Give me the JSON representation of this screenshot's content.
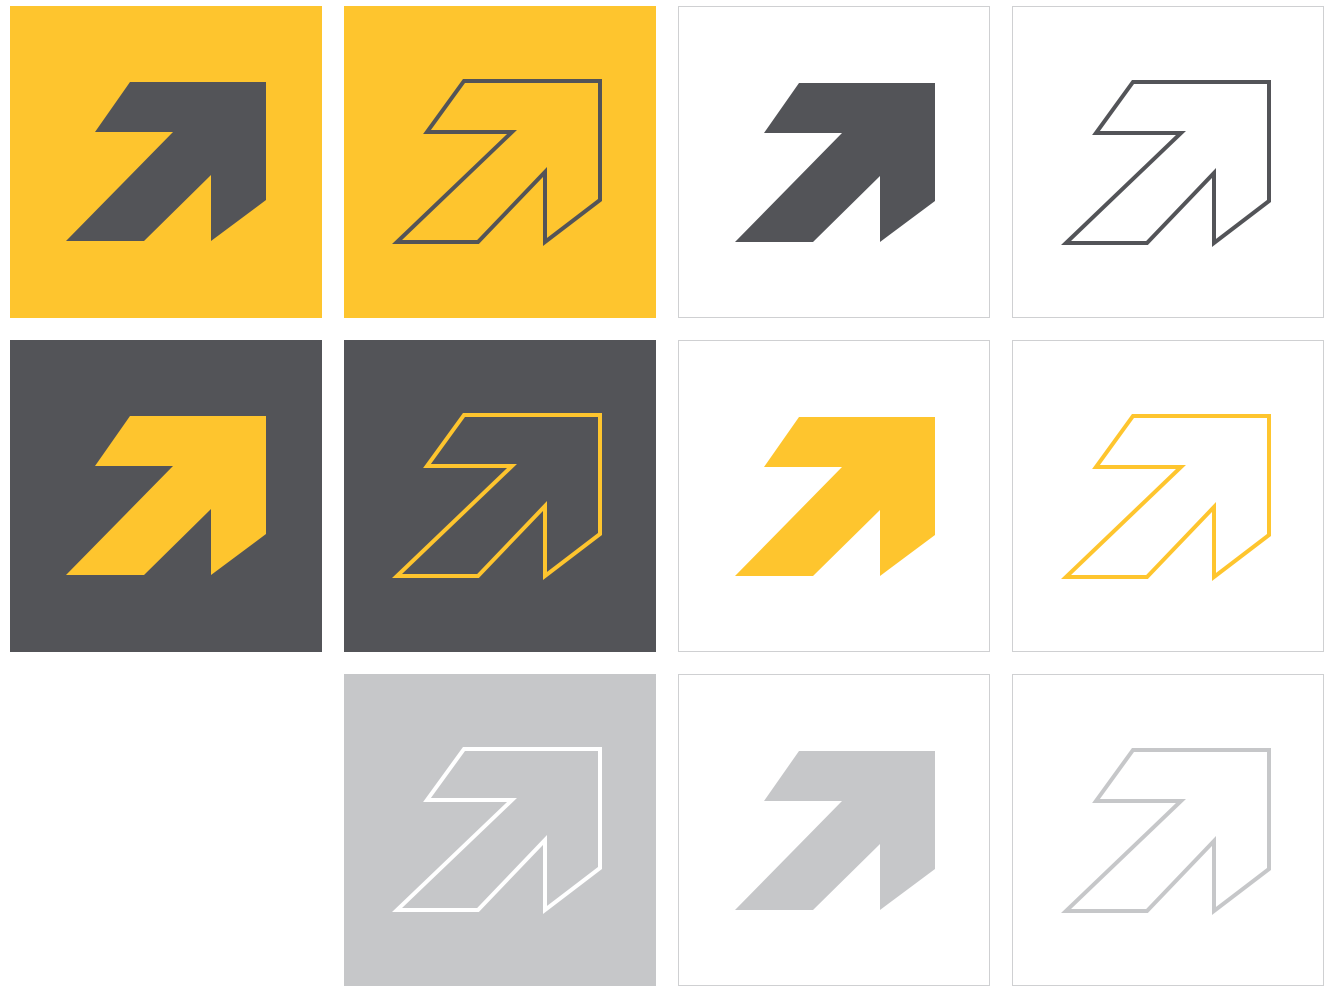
{
  "colors": {
    "yellow": "#fec52e",
    "charcoal": "#535458",
    "light_gray": "#c6c7c9",
    "white": "#ffffff",
    "tile_border": "#cfd0d2"
  },
  "tiles": [
    {
      "name": "arrow-tile-yellow-bg-solid-charcoal",
      "bg": "#fec52e",
      "style": "solid",
      "mark": "#535458",
      "bordered": false
    },
    {
      "name": "arrow-tile-yellow-bg-outline-charcoal",
      "bg": "#fec52e",
      "style": "outline",
      "mark": "#535458",
      "bordered": false
    },
    {
      "name": "arrow-tile-white-bg-solid-charcoal",
      "bg": "#ffffff",
      "style": "solid",
      "mark": "#535458",
      "bordered": true
    },
    {
      "name": "arrow-tile-white-bg-outline-charcoal",
      "bg": "#ffffff",
      "style": "outline",
      "mark": "#535458",
      "bordered": true
    },
    {
      "name": "arrow-tile-charcoal-bg-solid-yellow",
      "bg": "#535458",
      "style": "solid",
      "mark": "#fec52e",
      "bordered": false
    },
    {
      "name": "arrow-tile-charcoal-bg-outline-yellow",
      "bg": "#535458",
      "style": "outline",
      "mark": "#fec52e",
      "bordered": false
    },
    {
      "name": "arrow-tile-white-bg-solid-yellow",
      "bg": "#ffffff",
      "style": "solid",
      "mark": "#fec52e",
      "bordered": true
    },
    {
      "name": "arrow-tile-white-bg-outline-yellow",
      "bg": "#ffffff",
      "style": "outline",
      "mark": "#fec52e",
      "bordered": true
    },
    {
      "name": "arrow-tile-gray-bg-outline-white",
      "bg": "#c6c7c9",
      "style": "outline",
      "mark": "#ffffff",
      "bordered": false
    },
    {
      "name": "arrow-tile-white-bg-solid-gray",
      "bg": "#ffffff",
      "style": "solid",
      "mark": "#c6c7c9",
      "bordered": true
    },
    {
      "name": "arrow-tile-white-bg-outline-gray",
      "bg": "#ffffff",
      "style": "outline",
      "mark": "#c6c7c9",
      "bordered": true
    }
  ],
  "icon": "diagonal-arrow-icon"
}
